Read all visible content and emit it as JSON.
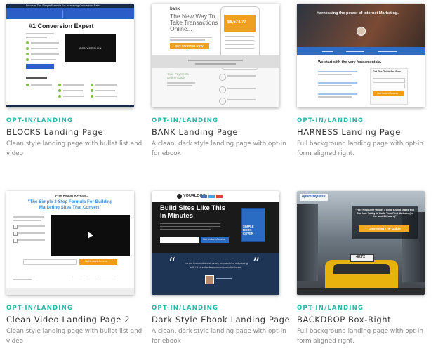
{
  "templates": [
    {
      "category": "OPT-IN/LANDING",
      "title": "BLOCKS Landing Page",
      "description": "Clean style landing page with bullet list and video",
      "preview": {
        "banner": "Discover The Simple Formula For Increasing Conversion Rates",
        "headline": "#1 Conversion Expert",
        "video_text": "CONVERSION"
      }
    },
    {
      "category": "OPT-IN/LANDING",
      "title": "BANK Landing Page",
      "description": "A clean, dark style landing page with opt-in for ebook",
      "preview": {
        "logo": "bank",
        "headline": "The New Way To Take Transactions Online...",
        "phone_amount": "$6,574.77",
        "cta": "GET STARTED NOW",
        "feature": "Take Payments Online Easily"
      }
    },
    {
      "category": "OPT-IN/LANDING",
      "title": "HARNESS Landing Page",
      "description": "Full background landing page with opt-in form aligned right.",
      "preview": {
        "headline": "Harnessing the power of Internet Marketing.",
        "section": "We start with the very fundamentals.",
        "form_title": "Get The Guide For Free",
        "cta": "Get Instant Access"
      }
    },
    {
      "category": "OPT-IN/LANDING",
      "title": "Clean Video Landing Page 2",
      "description": "Clean style landing page with bullet list and video",
      "preview": {
        "kicker": "Free Report Reveals...",
        "headline": "\"The Simple 3-Step Formula For Building Marketing Sites That Convert\"",
        "cta": "Get Instant Access"
      }
    },
    {
      "category": "OPT-IN/LANDING",
      "title": "Dark Style Ebook Landing Page",
      "description": "A clean, dark style landing page with opt-in for ebook",
      "preview": {
        "logo": "YOURLOGO",
        "headline": "Build Sites Like This In Minutes",
        "book": "SIMPLE BOOK COVER",
        "cta": "Get Instant Access",
        "testimonial": "Lorem ipsum dolor sit amet, consectetur adipiscing elit. Ut ut enim fermentum convallis lorem."
      }
    },
    {
      "category": "OPT-IN/LANDING",
      "title": "BACKDROP Box-Right",
      "description": "Full background landing page with opt-in form aligned right.",
      "preview": {
        "logo": "optimizepress",
        "box_text": "\"Free Resource Guide: 3 Little Known Apps You Can Use Today to Build Your First Website (in the next 24 hours)\"",
        "cta": "Download The Guide",
        "taxi_sign": "4K72"
      }
    }
  ],
  "colors": {
    "accent_teal": "#26b8a6",
    "blocks_blue": "#2b5fc7",
    "bank_orange": "#f0a020",
    "harness_orange": "#f39c12",
    "clean_video_blue": "#3d8fd8",
    "dark_navy": "#1f3556",
    "backdrop_orange": "#f5a623"
  }
}
